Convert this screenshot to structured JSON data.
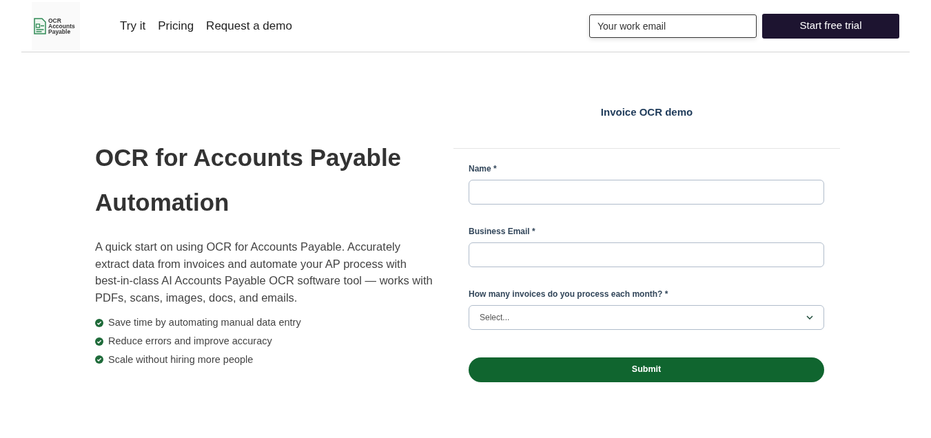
{
  "header": {
    "logo_lines": [
      "OCR",
      "Accounts",
      "Payable"
    ],
    "nav": [
      "Try it",
      "Pricing",
      "Request a demo"
    ],
    "email_placeholder": "Your work email",
    "cta": "Start free trial"
  },
  "hero": {
    "title": "OCR for Accounts Payable Automation",
    "description": "A quick start on using OCR for Accounts Payable. Accurately extract data from invoices and automate your AP process with best-in-class AI Accounts Payable OCR software tool — works with PDFs, scans, images, docs, and emails.",
    "benefits": [
      "Save time by automating manual data entry",
      "Reduce errors and improve accuracy",
      "Scale without hiring more people"
    ]
  },
  "form": {
    "title": "Invoice OCR demo",
    "fields": [
      {
        "kind": "text",
        "label": "Name *"
      },
      {
        "kind": "text",
        "label": "Business Email *"
      },
      {
        "kind": "select",
        "label": "How many invoices do you process each month? *",
        "placeholder": "Select..."
      }
    ],
    "submit": "Submit"
  }
}
